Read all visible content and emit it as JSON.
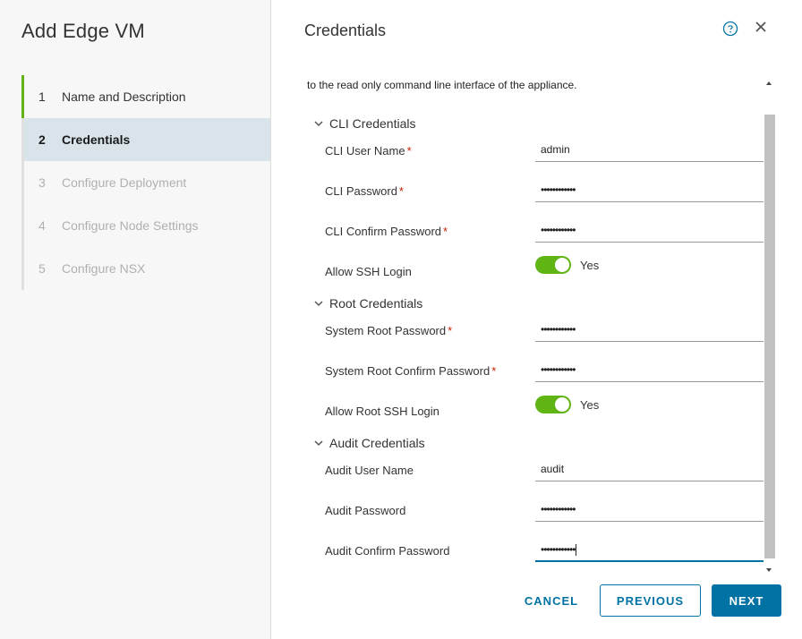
{
  "wizard": {
    "title": "Add Edge VM",
    "steps": [
      {
        "num": "1",
        "label": "Name and Description"
      },
      {
        "num": "2",
        "label": "Credentials"
      },
      {
        "num": "3",
        "label": "Configure Deployment"
      },
      {
        "num": "4",
        "label": "Configure Node Settings"
      },
      {
        "num": "5",
        "label": "Configure NSX"
      }
    ]
  },
  "main": {
    "title": "Credentials",
    "intro": "to the read only command line interface of the appliance.",
    "cli": {
      "heading": "CLI Credentials",
      "user_label": "CLI User Name",
      "user_value": "admin",
      "password_label": "CLI Password",
      "password_value": "••••••••••••",
      "confirm_label": "CLI Confirm Password",
      "confirm_value": "••••••••••••",
      "ssh_label": "Allow SSH Login",
      "ssh_value": "Yes"
    },
    "root": {
      "heading": "Root Credentials",
      "password_label": "System Root Password",
      "password_value": "••••••••••••",
      "confirm_label": "System Root Confirm Password",
      "confirm_value": "••••••••••••",
      "ssh_label": "Allow Root SSH Login",
      "ssh_value": "Yes"
    },
    "audit": {
      "heading": "Audit Credentials",
      "user_label": "Audit User Name",
      "user_value": "audit",
      "password_label": "Audit Password",
      "password_value": "••••••••••••",
      "confirm_label": "Audit Confirm Password",
      "confirm_value": "••••••••••••"
    },
    "required_mark": "*"
  },
  "footer": {
    "cancel": "CANCEL",
    "previous": "PREVIOUS",
    "next": "NEXT"
  },
  "colors": {
    "accent": "#0072a3",
    "toggle_on": "#60b515",
    "required": "#c92100",
    "active_step_bg": "#d9e4ea"
  },
  "icons": {
    "help": "help-circle-icon",
    "close": "close-icon",
    "chevron": "chevron-down-icon"
  }
}
